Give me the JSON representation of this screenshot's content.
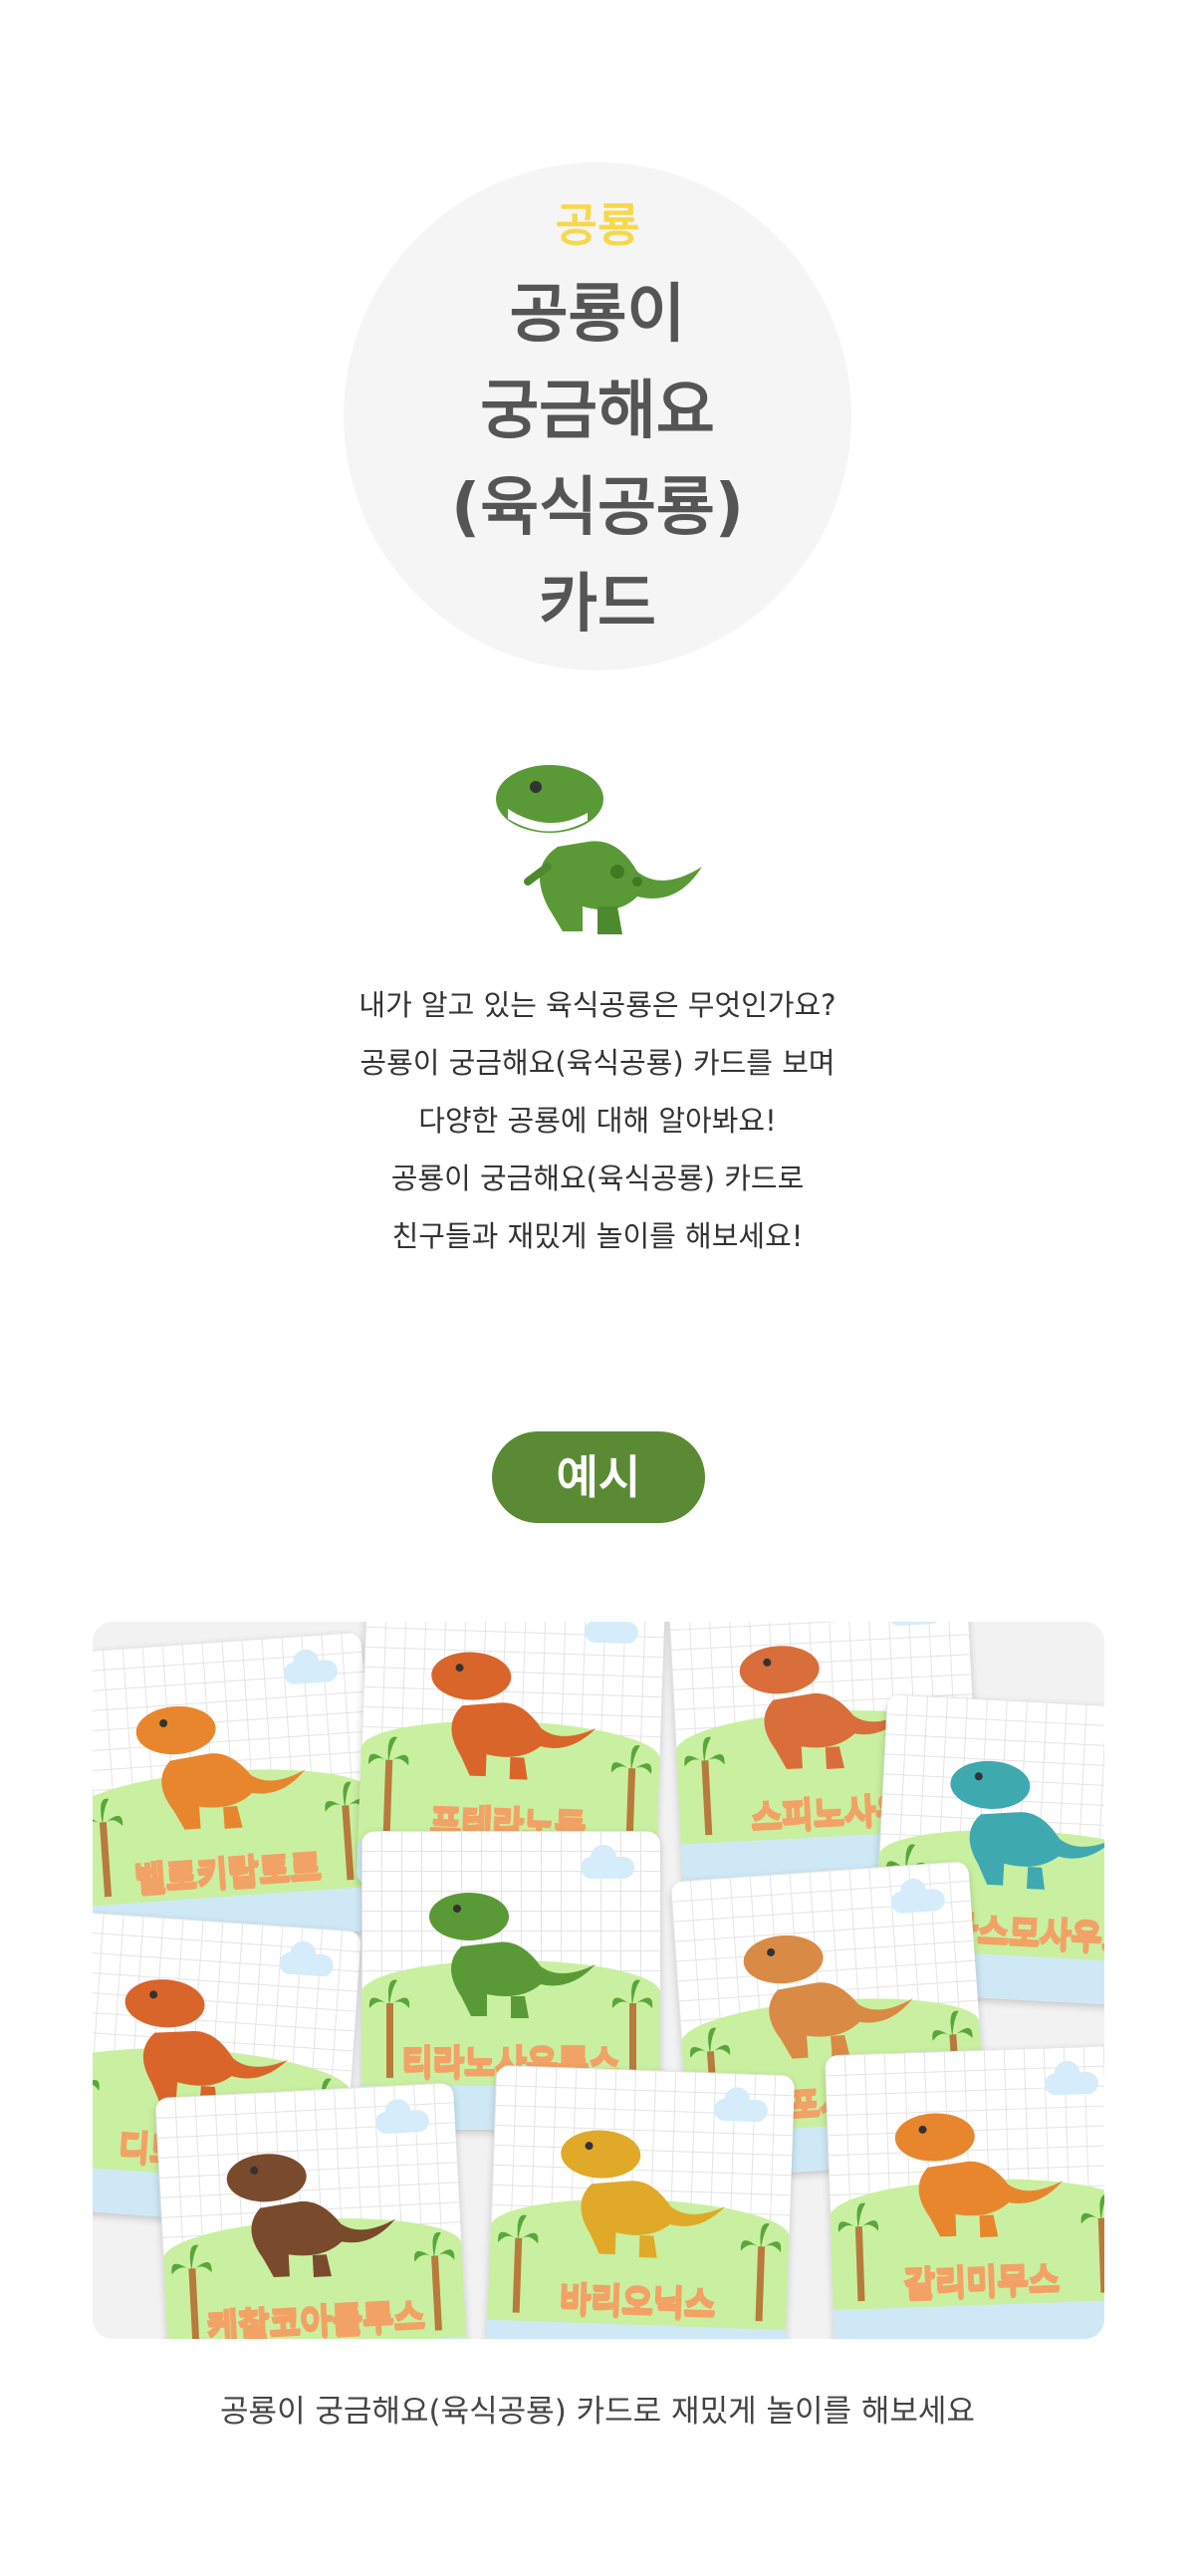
{
  "hero": {
    "category": "공룡",
    "title_lines": [
      "공룡이",
      "궁금해요",
      "(육식공룡)",
      "카드"
    ]
  },
  "intro_lines": [
    "내가 알고 있는 육식공룡은 무엇인가요?",
    "공룡이 궁금해요(육식공룡) 카드를 보며",
    "다양한 공룡에 대해 알아봐요!",
    "공룡이 궁금해요(육식공룡) 카드로",
    "친구들과 재밌게 놀이를 해보세요!"
  ],
  "example_label": "예시",
  "cards": [
    {
      "name": "벨로키랍토르",
      "dino_color": "#e8862e"
    },
    {
      "name": "프테라노돈",
      "dino_color": "#d9652a"
    },
    {
      "name": "스피노사우",
      "dino_color": "#d96e3a"
    },
    {
      "name": "엘라스모사우르",
      "dino_color": "#3fa9b0"
    },
    {
      "name": "디모르포돈",
      "dino_color": "#d9652a"
    },
    {
      "name": "티라노사우루스",
      "dino_color": "#5a9a36"
    },
    {
      "name": "프로포사우루스",
      "dino_color": "#d98a45"
    },
    {
      "name": "케찰코아틀루스",
      "dino_color": "#7a4a2c"
    },
    {
      "name": "바리오닉스",
      "dino_color": "#e0a928"
    },
    {
      "name": "갈리미무스",
      "dino_color": "#e8862e"
    }
  ],
  "caption": "공룡이 궁금해요(육식공룡) 카드로 재밌게 놀이를 해보세요",
  "colors": {
    "accent_green": "#5b8a34",
    "accent_yellow": "#f7d84a",
    "card_label_orange": "#f2a265"
  }
}
